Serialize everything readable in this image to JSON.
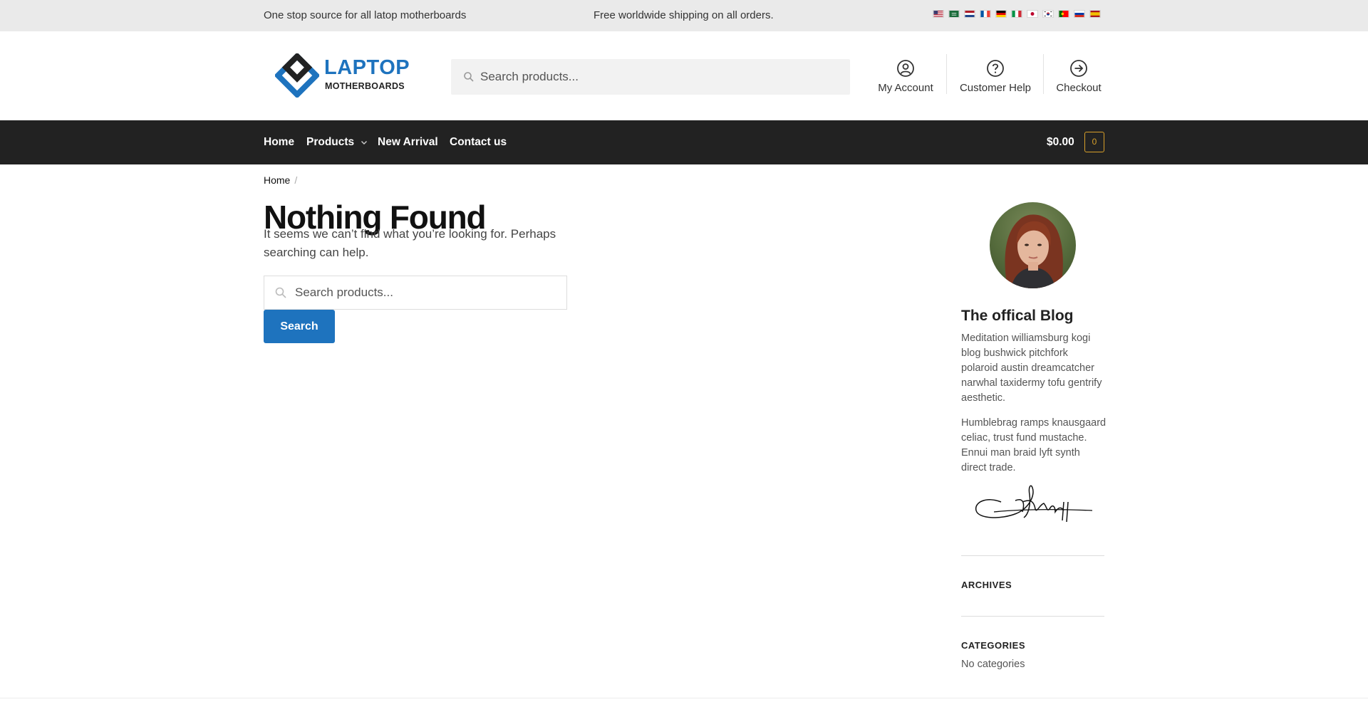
{
  "topbar": {
    "left_message": "One stop source for all latop motherboards",
    "center_message": "Free worldwide shipping on all orders.",
    "flags": [
      "us-flag-icon",
      "sa-flag-icon",
      "nl-flag-icon",
      "fr-flag-icon",
      "de-flag-icon",
      "it-flag-icon",
      "jp-flag-icon",
      "kr-flag-icon",
      "pt-flag-icon",
      "ru-flag-icon",
      "es-flag-icon"
    ]
  },
  "header": {
    "logo_line1": "LAPTOP",
    "logo_line2": "MOTHERBOARDS",
    "search_placeholder": "Search products...",
    "links": {
      "account": "My Account",
      "help": "Customer Help",
      "checkout": "Checkout"
    }
  },
  "nav": {
    "items": [
      "Home",
      "Products",
      "New Arrival",
      "Contact us"
    ],
    "cart_total": "$0.00",
    "cart_count": "0"
  },
  "breadcrumb": {
    "home": "Home",
    "separator": "/"
  },
  "main": {
    "title": "Nothing Found",
    "message": "It seems we can’t find what you’re looking for. Perhaps searching can help.",
    "search_placeholder": "Search products...",
    "search_button": "Search"
  },
  "sidebar": {
    "blog_title": "The offical Blog",
    "paragraph1": "Meditation williamsburg kogi blog bushwick pitchfork polaroid austin dreamcatcher narwhal taxidermy tofu gentrify aesthetic.",
    "paragraph2": "Humblebrag ramps knausgaard celiac, trust fund mustache. Ennui man braid lyft synth direct trade.",
    "archives_heading": "ARCHIVES",
    "categories_heading": "CATEGORIES",
    "categories_empty": "No categories"
  },
  "colors": {
    "accent": "#1e73be",
    "nav_background": "#222222",
    "topbar_background": "#eaeaea",
    "cart_badge": "#d8a02a"
  }
}
